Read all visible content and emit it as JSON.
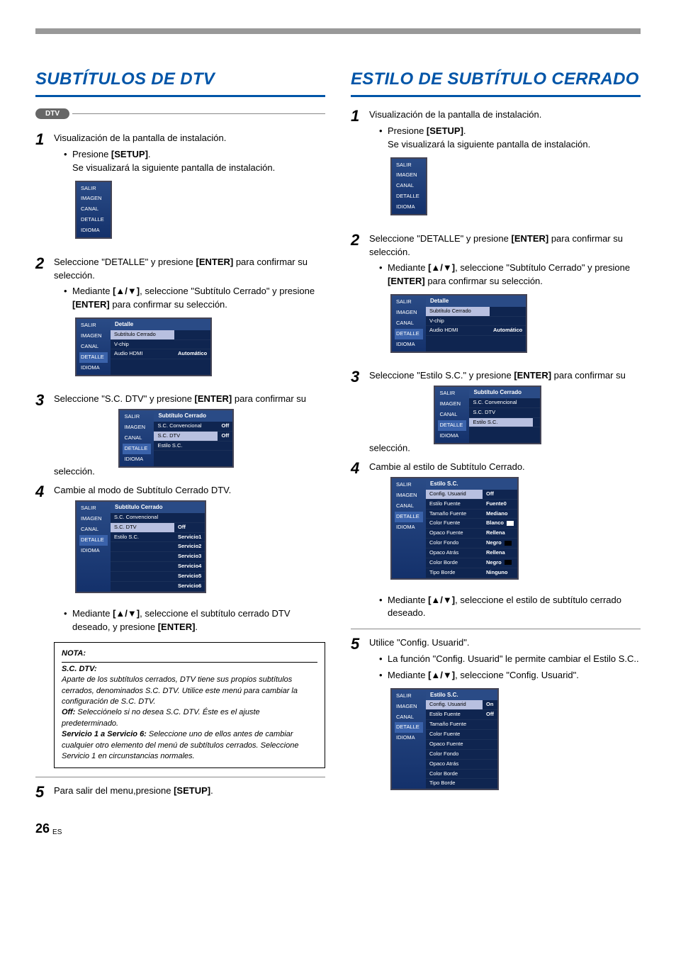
{
  "page_number": "26",
  "page_lang": "ES",
  "left": {
    "heading": "SUBTÍTULOS DE DTV",
    "badge": "DTV",
    "steps": {
      "s1": {
        "text": "Visualización de la pantalla de instalación.",
        "b1_pre": "Presione ",
        "b1_bold": "[SETUP]",
        "b1_post": ".",
        "b1_line2": "Se visualizará la siguiente pantalla de instalación."
      },
      "s2": {
        "text_pre": "Seleccione \"DETALLE\" y presione ",
        "text_bold": "[ENTER]",
        "text_post": " para confirmar su selección.",
        "b1_pre": "Mediante ",
        "b1_bold1": "[▲/▼]",
        "b1_mid": ", seleccione \"Subtítulo Cerrado\" y presione ",
        "b1_bold2": "[ENTER]",
        "b1_post": " para confirmar su selección."
      },
      "s3": {
        "text_pre": "Seleccione \"S.C. DTV\" y presione ",
        "text_bold": "[ENTER]",
        "text_post": " para confirmar su selección."
      },
      "s4": {
        "text": "Cambie al modo de Subtítulo Cerrado DTV.",
        "b1_pre": "Mediante ",
        "b1_bold1": "[▲/▼]",
        "b1_mid": ", seleccione el subtítulo cerrado DTV deseado, y presione ",
        "b1_bold2": "[ENTER]",
        "b1_post": "."
      },
      "s5": {
        "text_pre": "Para salir del menu,presione ",
        "text_bold": "[SETUP]",
        "text_post": "."
      }
    },
    "note": {
      "title": "NOTA:",
      "subtitle": "S.C. DTV:",
      "para1": "Aparte de los subtítulos cerrados, DTV tiene sus propios subtítulos cerrados, denominados S.C. DTV. Utilice este menú para cambiar la configuración de S.C. DTV.",
      "off_lbl": "Off:",
      "off_txt": " Selecciónelo si no desea S.C. DTV. Éste es el ajuste predeterminado.",
      "svc_lbl": "Servicio 1 a Servicio 6:",
      "svc_txt": " Seleccione uno de ellos antes de cambiar cualquier otro elemento del menú de subtítulos cerrados. Seleccione Servicio 1 en circunstancias normales."
    },
    "osd": {
      "menu1": {
        "items": [
          "SALIR",
          "IMAGEN",
          "CANAL",
          "DETALLE",
          "IDIOMA"
        ]
      },
      "menu2": {
        "side": [
          "SALIR",
          "IMAGEN",
          "CANAL",
          "DETALLE",
          "IDIOMA"
        ],
        "title": "Detalle",
        "rows": [
          {
            "k": "Subtítulo Cerrado",
            "v": "",
            "hi": true
          },
          {
            "k": "V-chip",
            "v": ""
          },
          {
            "k": "Audio HDMI",
            "v": "Automático"
          }
        ]
      },
      "menu3": {
        "side": [
          "SALIR",
          "IMAGEN",
          "CANAL",
          "DETALLE",
          "IDIOMA"
        ],
        "title": "Subtítulo Cerrado",
        "rows": [
          {
            "k": "S.C. Convencional",
            "v": "Off"
          },
          {
            "k": "S.C. DTV",
            "v": "Off",
            "hi": true
          },
          {
            "k": "Estilo S.C.",
            "v": ""
          }
        ]
      },
      "menu4": {
        "side": [
          "SALIR",
          "IMAGEN",
          "CANAL",
          "DETALLE",
          "IDIOMA"
        ],
        "title": "Subtítulo Cerrado",
        "rows": [
          {
            "k": "S.C. Convencional",
            "v": ""
          },
          {
            "k": "S.C. DTV",
            "v": "Off",
            "hi": true
          },
          {
            "k": "Estilo S.C.",
            "v": "Servicio1"
          },
          {
            "k": "",
            "v": "Servicio2"
          },
          {
            "k": "",
            "v": "Servicio3"
          },
          {
            "k": "",
            "v": "Servicio4"
          },
          {
            "k": "",
            "v": "Servicio5"
          },
          {
            "k": "",
            "v": "Servicio6"
          }
        ]
      }
    }
  },
  "right": {
    "heading": "ESTILO DE SUBTÍTULO CERRADO",
    "steps": {
      "s1": {
        "text": "Visualización de la pantalla de instalación.",
        "b1_pre": "Presione ",
        "b1_bold": "[SETUP]",
        "b1_post": ".",
        "b1_line2": "Se visualizará la siguiente pantalla de instalación."
      },
      "s2": {
        "text_pre": "Seleccione \"DETALLE\" y presione ",
        "text_bold": "[ENTER]",
        "text_post": " para confirmar su selección.",
        "b1_pre": "Mediante ",
        "b1_bold1": "[▲/▼]",
        "b1_mid": ", seleccione \"Subtítulo Cerrado\" y presione ",
        "b1_bold2": "[ENTER]",
        "b1_post": " para confirmar su selección."
      },
      "s3": {
        "text_pre": "Seleccione \"Estilo S.C.\" y presione ",
        "text_bold": "[ENTER]",
        "text_post": " para confirmar su selección."
      },
      "s4": {
        "text": "Cambie al estilo de Subtítulo Cerrado.",
        "b1_pre": "Mediante ",
        "b1_bold1": "[▲/▼]",
        "b1_post": ", seleccione el estilo de subtítulo cerrado deseado."
      },
      "s5": {
        "text": "Utilice \"Config. Usuarid\".",
        "b1": "La función \"Config. Usuarid\" le permite cambiar el Estilo S.C..",
        "b2_pre": "Mediante ",
        "b2_bold": "[▲/▼]",
        "b2_post": ", seleccione \"Config. Usuarid\"."
      }
    },
    "osd": {
      "menu1": {
        "items": [
          "SALIR",
          "IMAGEN",
          "CANAL",
          "DETALLE",
          "IDIOMA"
        ]
      },
      "menu2": {
        "side": [
          "SALIR",
          "IMAGEN",
          "CANAL",
          "DETALLE",
          "IDIOMA"
        ],
        "title": "Detalle",
        "rows": [
          {
            "k": "Subtítulo Cerrado",
            "v": "",
            "hi": true
          },
          {
            "k": "V-chip",
            "v": ""
          },
          {
            "k": "Audio HDMI",
            "v": "Automático"
          }
        ]
      },
      "menu3": {
        "side": [
          "SALIR",
          "IMAGEN",
          "CANAL",
          "DETALLE",
          "IDIOMA"
        ],
        "title": "Subtítulo Cerrado",
        "rows": [
          {
            "k": "S.C. Convencional",
            "v": ""
          },
          {
            "k": "S.C. DTV",
            "v": ""
          },
          {
            "k": "Estilo S.C.",
            "v": "",
            "hi": true
          }
        ]
      },
      "menu4": {
        "side": [
          "SALIR",
          "IMAGEN",
          "CANAL",
          "DETALLE",
          "IDIOMA"
        ],
        "title": "Estilo S.C.",
        "rows": [
          {
            "k": "Config. Usuarid",
            "v": "Off",
            "hi": true
          },
          {
            "k": "Estilo Fuente",
            "v": "Fuente0"
          },
          {
            "k": "Tamaño Fuente",
            "v": "Mediano"
          },
          {
            "k": "Color Fuente",
            "v": "Blanco",
            "sw": true
          },
          {
            "k": "Opaco Fuente",
            "v": "Rellena"
          },
          {
            "k": "Color Fondo",
            "v": "Negro",
            "sw": true
          },
          {
            "k": "Opaco Atrás",
            "v": "Rellena"
          },
          {
            "k": "Color Borde",
            "v": "Negro",
            "sw": true
          },
          {
            "k": "Tipo Borde",
            "v": "Ninguno"
          }
        ]
      },
      "menu5": {
        "side": [
          "SALIR",
          "IMAGEN",
          "CANAL",
          "DETALLE",
          "IDIOMA"
        ],
        "title": "Estilo S.C.",
        "rows": [
          {
            "k": "Config. Usuarid",
            "v": "On",
            "hi": true
          },
          {
            "k": "Estilo Fuente",
            "v": "Off"
          },
          {
            "k": "Tamaño Fuente",
            "v": ""
          },
          {
            "k": "Color Fuente",
            "v": ""
          },
          {
            "k": "Opaco Fuente",
            "v": ""
          },
          {
            "k": "Color Fondo",
            "v": ""
          },
          {
            "k": "Opaco Atrás",
            "v": ""
          },
          {
            "k": "Color Borde",
            "v": ""
          },
          {
            "k": "Tipo Borde",
            "v": ""
          }
        ]
      }
    }
  }
}
